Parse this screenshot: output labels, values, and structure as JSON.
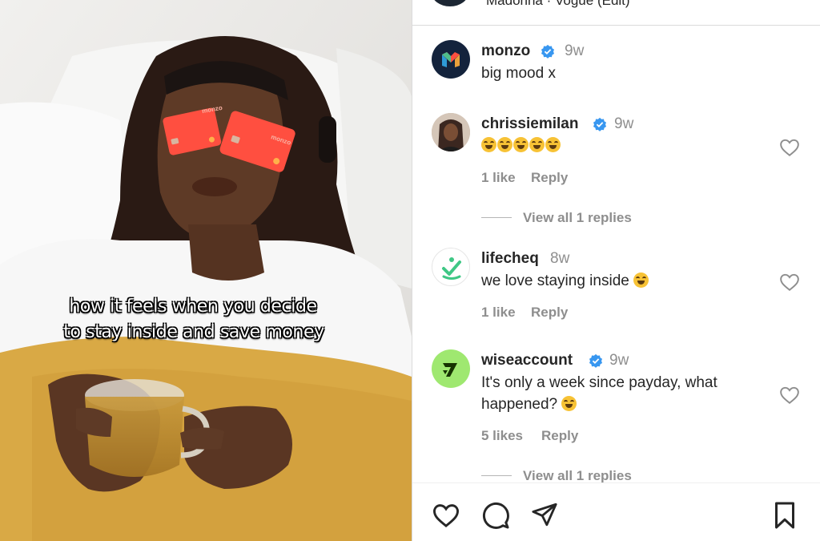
{
  "header": {
    "subtitle": "Madonna · Vogue (Edit)"
  },
  "media": {
    "caption_line1": "how it feels when you decide",
    "caption_line2": "to stay inside and save money",
    "card_logo": "monzo"
  },
  "comments": [
    {
      "username": "monzo",
      "verified": true,
      "time": "9w",
      "text": "big mood x"
    },
    {
      "username": "chrissiemilan",
      "verified": true,
      "time": "9w",
      "likes": "1 like",
      "reply": "Reply",
      "view_replies": "View all 1 replies"
    },
    {
      "username": "lifecheq",
      "verified": false,
      "time": "8w",
      "text": "we love staying inside",
      "likes": "1 like",
      "reply": "Reply"
    },
    {
      "username": "wiseaccount",
      "verified": true,
      "time": "9w",
      "text_line1": "It's only a week since payday, what",
      "text_line2": "happened?",
      "likes": "5 likes",
      "reply": "Reply",
      "view_replies": "View all 1 replies"
    }
  ],
  "icons": {
    "verified": "verified-badge-icon",
    "like": "heart-icon",
    "comment": "comment-icon",
    "share": "send-icon",
    "save": "bookmark-icon"
  },
  "colors": {
    "verified": "#3897f0",
    "monzo_card": "#ff4f40",
    "wise_green": "#9fe870",
    "lifecheq_green": "#3fc785"
  }
}
